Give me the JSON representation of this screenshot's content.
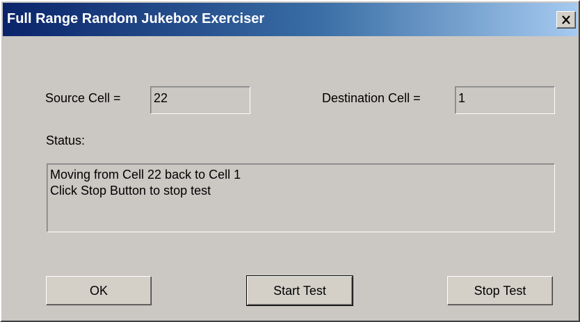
{
  "window": {
    "title": "Full Range Random Jukebox Exerciser",
    "close_label": "×"
  },
  "form": {
    "source_label": "Source Cell =",
    "source_value": "22",
    "destination_label": "Destination Cell =",
    "destination_value": "1",
    "status_label": "Status:",
    "status_lines": [
      "Moving from Cell 22 back to Cell 1",
      "Click Stop Button to stop test"
    ]
  },
  "buttons": {
    "ok": "OK",
    "start": "Start Test",
    "stop": "Stop Test"
  },
  "colors": {
    "title_start": "#0a246a",
    "title_end": "#a6caf0",
    "face": "#cbc7c3"
  }
}
